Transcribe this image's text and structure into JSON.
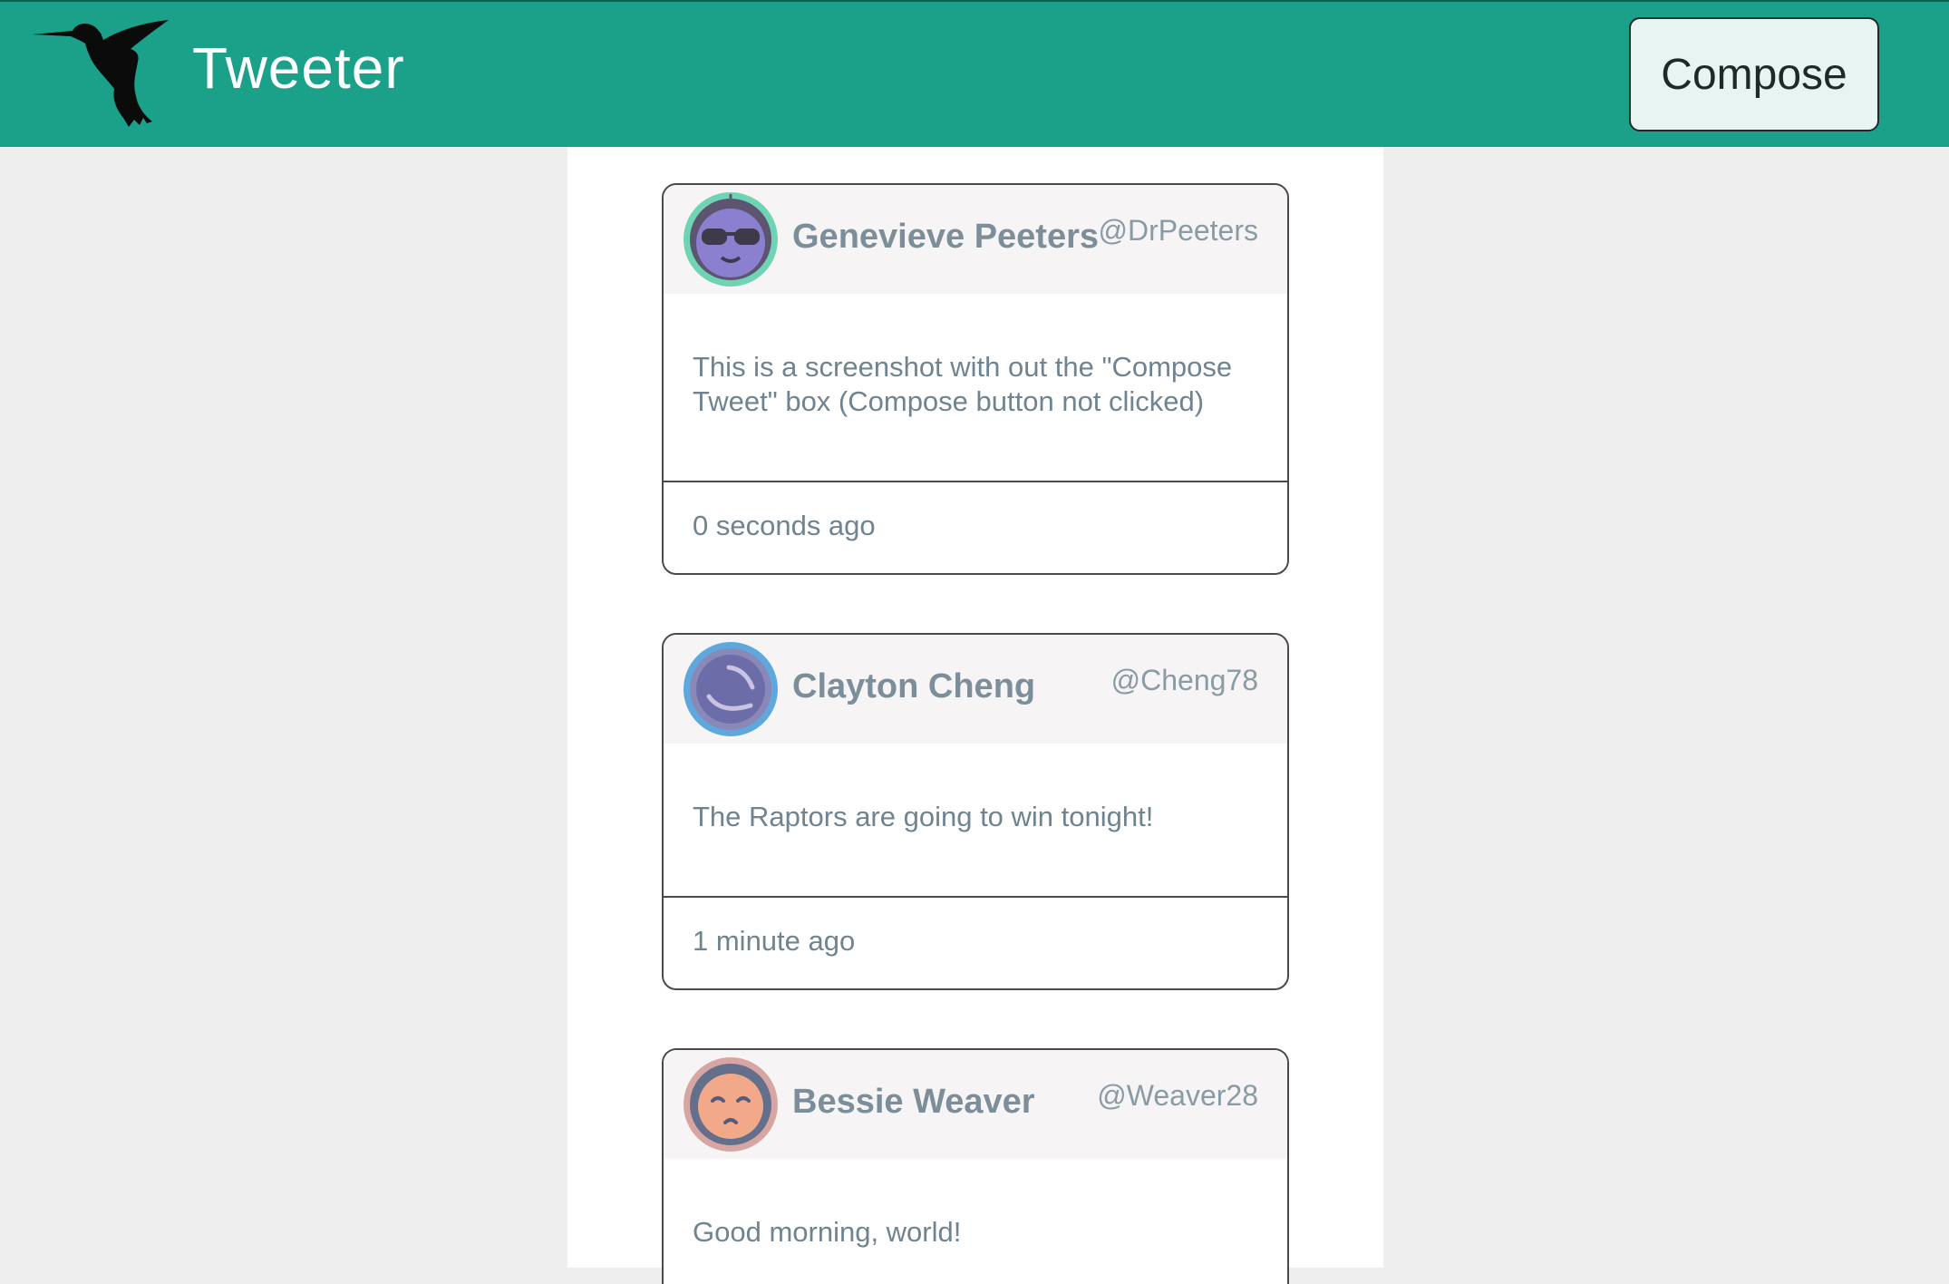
{
  "header": {
    "brand": "Tweeter",
    "logo_icon": "hummingbird-icon",
    "compose_label": "Compose",
    "colors": {
      "navbar": "#1ba189",
      "compose_bg": "#e8f4f1"
    }
  },
  "tweets": [
    {
      "name": "Genevieve Peeters",
      "handle": "@DrPeeters",
      "text": "This is a screenshot with out the \"Compose Tweet\" box (Compose button not clicked)",
      "time": "0 seconds ago",
      "avatar_icon": "sunglasses-avatar-icon",
      "avatar_ring": "#6fd4b3"
    },
    {
      "name": "Clayton Cheng",
      "handle": "@Cheng78",
      "text": "The Raptors are going to win tonight!",
      "time": "1 minute ago",
      "avatar_icon": "planet-avatar-icon",
      "avatar_ring": "#5ea8de"
    },
    {
      "name": "Bessie Weaver",
      "handle": "@Weaver28",
      "text": "Good morning, world!",
      "time": "",
      "avatar_icon": "sleepy-face-avatar-icon",
      "avatar_ring": "#d8a6a2"
    }
  ]
}
